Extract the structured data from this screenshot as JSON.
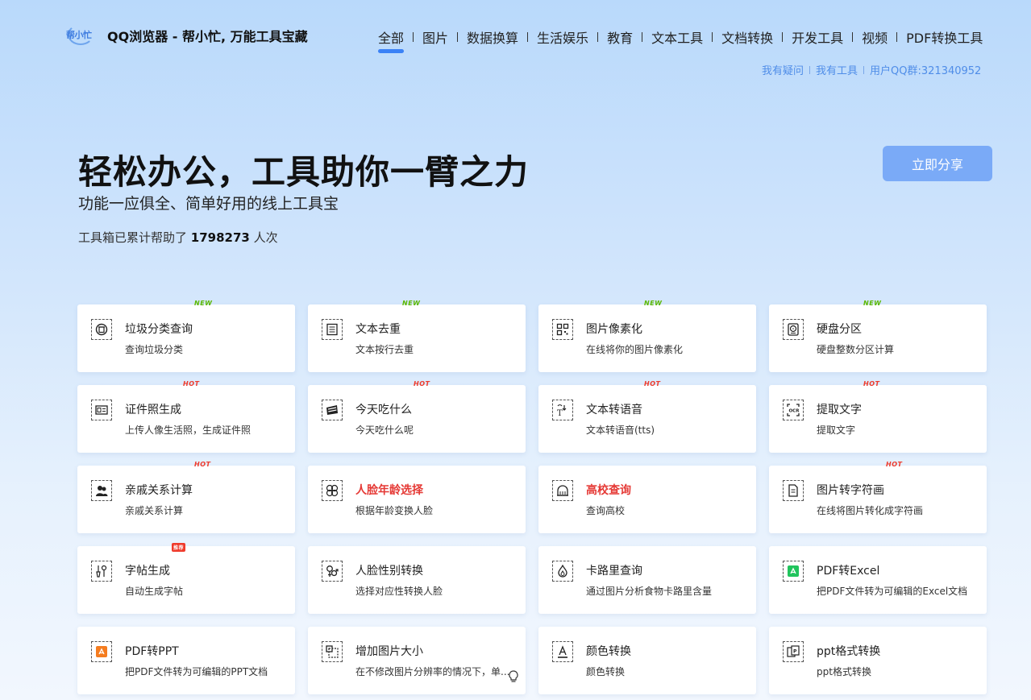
{
  "header": {
    "logo_text": "帮小忙",
    "site_title": "QQ浏览器 - 帮小忙, 万能工具宝藏",
    "nav": [
      "全部",
      "图片",
      "数据换算",
      "生活娱乐",
      "教育",
      "文本工具",
      "文档转换",
      "开发工具",
      "视频",
      "PDF转换工具"
    ],
    "active_nav": "全部",
    "subnav": [
      "我有疑问",
      "我有工具",
      "用户QQ群:321340952"
    ]
  },
  "hero": {
    "title": "轻松办公，工具助你一臂之力",
    "subtitle": "功能一应俱全、简单好用的线上工具宝",
    "count_prefix": "工具箱已累计帮助了",
    "count_value": "1798273",
    "count_suffix": "人次",
    "share_button": "立即分享"
  },
  "tools": [
    {
      "name": "垃圾分类查询",
      "desc": "查询垃圾分类",
      "badge": "NEW",
      "icon": "trash-icon"
    },
    {
      "name": "文本去重",
      "desc": "文本按行去重",
      "badge": "NEW",
      "icon": "document-icon"
    },
    {
      "name": "图片像素化",
      "desc": "在线将你的图片像素化",
      "badge": "NEW",
      "icon": "qrcode-icon"
    },
    {
      "name": "硬盘分区",
      "desc": "硬盘整数分区计算",
      "badge": "NEW",
      "icon": "harddisk-icon"
    },
    {
      "name": "证件照生成",
      "desc": "上传人像生活照，生成证件照",
      "badge": "HOT",
      "icon": "idcard-icon"
    },
    {
      "name": "今天吃什么",
      "desc": "今天吃什么呢",
      "badge": "HOT",
      "icon": "food-icon"
    },
    {
      "name": "文本转语音",
      "desc": "文本转语音(tts)",
      "badge": "HOT",
      "icon": "text-to-speech-icon"
    },
    {
      "name": "提取文字",
      "desc": "提取文字",
      "badge": "HOT",
      "icon": "ocr-icon"
    },
    {
      "name": "亲戚关系计算",
      "desc": "亲戚关系计算",
      "badge": "HOT",
      "icon": "people-icon"
    },
    {
      "name": "人脸年龄选择",
      "desc": "根据年龄变换人脸",
      "badge": "",
      "icon": "face-age-icon",
      "highlight": true
    },
    {
      "name": "高校查询",
      "desc": "查询高校",
      "badge": "",
      "icon": "school-icon",
      "highlight": true
    },
    {
      "name": "图片转字符画",
      "desc": "在线将图片转化成字符画",
      "badge": "HOT",
      "icon": "image-text-icon"
    },
    {
      "name": "字帖生成",
      "desc": "自动生成字帖",
      "badge": "推荐",
      "icon": "brush-icon"
    },
    {
      "name": "人脸性别转换",
      "desc": "选择对应性转换人脸",
      "badge": "",
      "icon": "gender-icon"
    },
    {
      "name": "卡路里查询",
      "desc": "通过图片分析食物卡路里含量",
      "badge": "",
      "icon": "flame-icon"
    },
    {
      "name": "PDF转Excel",
      "desc": "把PDF文件转为可编辑的Excel文档",
      "badge": "",
      "icon": "pdf-excel-icon"
    },
    {
      "name": "PDF转PPT",
      "desc": "把PDF文件转为可编辑的PPT文档",
      "badge": "",
      "icon": "pdf-ppt-icon"
    },
    {
      "name": "增加图片大小",
      "desc": "在不修改图片分辨率的情况下，单...",
      "badge": "",
      "icon": "resize-icon"
    },
    {
      "name": "颜色转换",
      "desc": "颜色转换",
      "badge": "",
      "icon": "color-icon"
    },
    {
      "name": "ppt格式转换",
      "desc": "ppt格式转换",
      "badge": "",
      "icon": "ppt-icon"
    }
  ],
  "colors": {
    "accent": "#3b82f6",
    "share_button": "#7aaaf7",
    "new_badge": "#5cb800",
    "hot_badge": "#ef3b2c",
    "highlight_text": "#e53935"
  }
}
